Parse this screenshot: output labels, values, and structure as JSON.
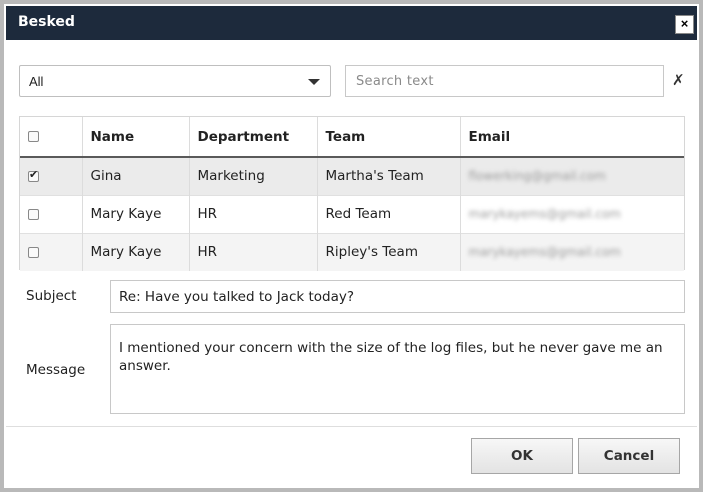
{
  "window": {
    "title": "Besked",
    "close_glyph": "×"
  },
  "filter": {
    "selected": "All"
  },
  "search": {
    "placeholder": "Search text",
    "value": "",
    "clear_glyph": "✗"
  },
  "table": {
    "columns": [
      "Name",
      "Department",
      "Team",
      "Email"
    ],
    "rows": [
      {
        "checked": true,
        "name": "Gina",
        "department": "Marketing",
        "team": "Martha's Team",
        "email": "flowerking@gmail.com"
      },
      {
        "checked": false,
        "name": "Mary Kaye",
        "department": "HR",
        "team": "Red Team",
        "email": "marykayems@gmail.com"
      },
      {
        "checked": false,
        "name": "Mary Kaye",
        "department": "HR",
        "team": "Ripley's Team",
        "email": "marykayems@gmail.com"
      }
    ]
  },
  "form": {
    "subject_label": "Subject",
    "subject_value": "Re: Have you talked to Jack today?",
    "message_label": "Message",
    "message_value": "I mentioned your concern with the size of the log files, but he never gave me an answer."
  },
  "buttons": {
    "ok": "OK",
    "cancel": "Cancel"
  }
}
